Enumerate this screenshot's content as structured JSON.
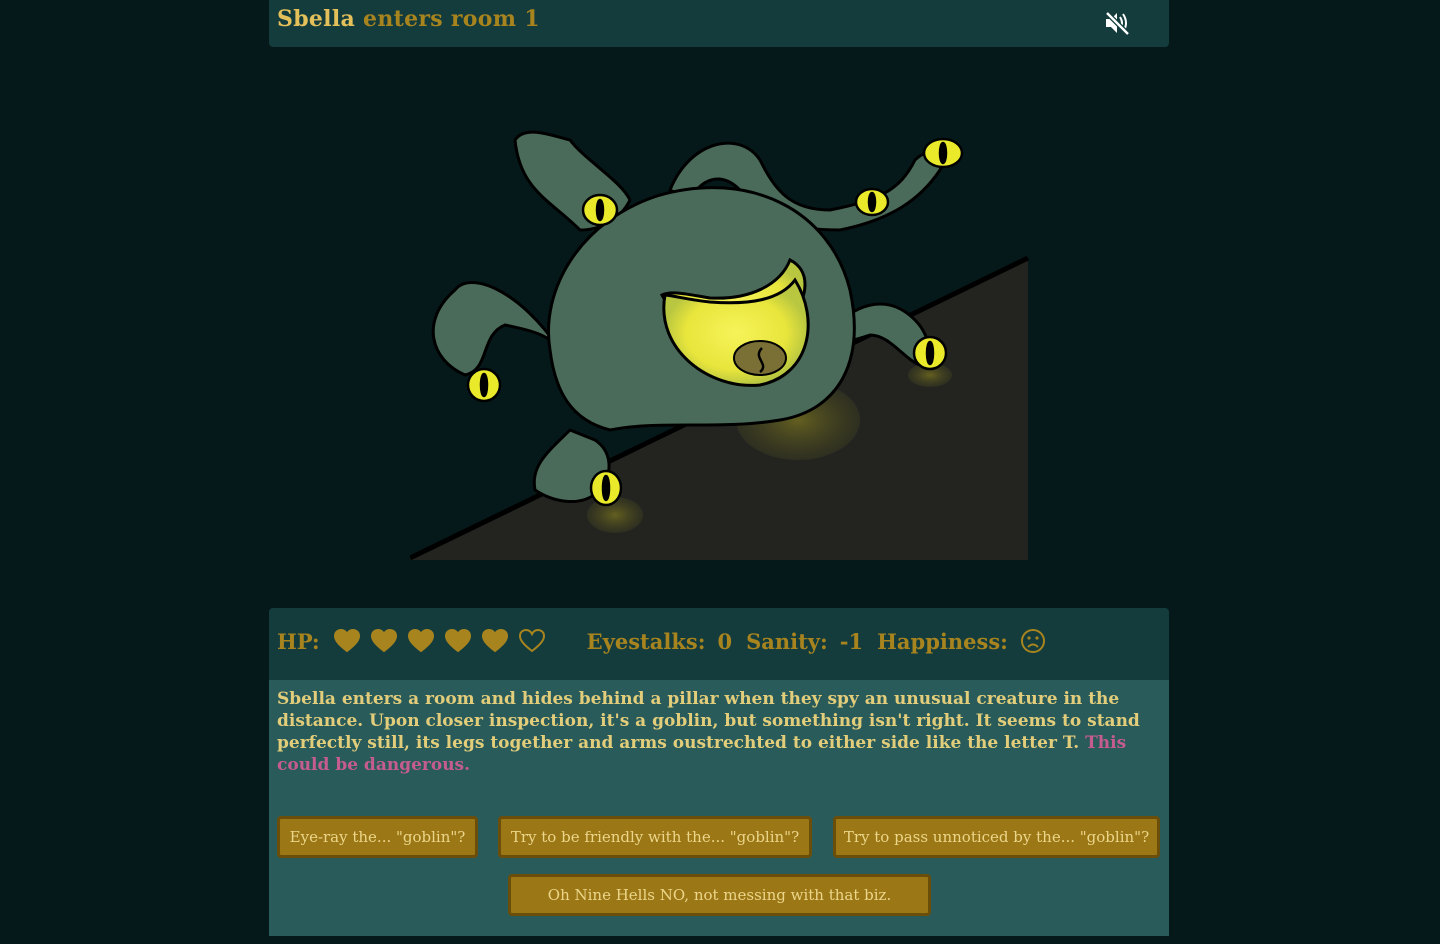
{
  "header": {
    "character_name": "Sbella",
    "room_text": "enters room 1",
    "mute_icon": "volume-mute-icon"
  },
  "stats": {
    "hp_label": "HP:",
    "hp_current": 5,
    "hp_max": 6,
    "eyestalks_label": "Eyestalks:",
    "eyestalks_value": "0",
    "sanity_label": "Sanity:",
    "sanity_value": "-1",
    "happiness_label": "Happiness:",
    "happiness_icon": "sad-face-icon"
  },
  "story": {
    "text": "Sbella enters a room and hides behind a pillar when they spy an unusual creature in the distance. Upon closer inspection, it's a goblin, but something isn't right. It seems to stand perfectly still, its legs together and arms oustrechted to either side like the letter T.",
    "warning": "This could be dangerous."
  },
  "choices": [
    "Eye-ray the... \"goblin\"?",
    "Try to be friendly with the... \"goblin\"?",
    "Try to pass unnoticed by the... \"goblin\"?",
    "Oh Nine Hells NO, not messing with that biz."
  ],
  "colors": {
    "background": "#06191a",
    "panel_dark": "#143c3c",
    "panel_light": "#2a5b5b",
    "gold": "#a8841f",
    "button": "#9b7716",
    "danger_text": "#c55c8e",
    "heart": "#a8841f"
  }
}
